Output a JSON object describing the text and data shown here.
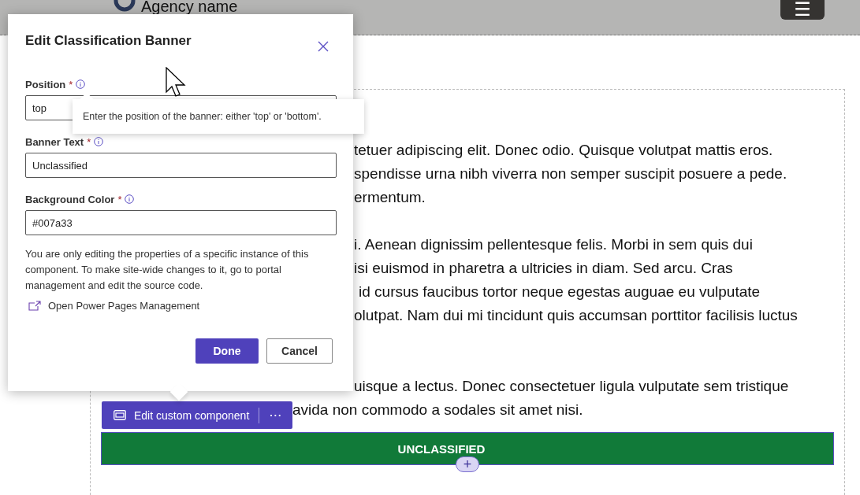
{
  "header": {
    "title": "Agency name",
    "menu_button": "☰"
  },
  "content": {
    "paragraphs": [
      {
        "lines": [
          {
            "text": "tetuer adipiscing elit. Donec odio. Quisque volutpat mattis eros.",
            "kind": "normal"
          },
          {
            "text": "spendisse urna nibh viverra non semper suscipit posuere a pede.",
            "kind": "normal"
          },
          {
            "text": "ermentum.",
            "kind": "normal"
          }
        ]
      },
      {
        "lines": [
          {
            "text": "i. Aenean dignissim pellentesque felis. Morbi in sem quis dui",
            "kind": "normal"
          },
          {
            "text": "isi euismod in pharetra a ultricies in diam. Sed arcu. Cras",
            "kind": "normal"
          },
          {
            "text": "id cursus faucibus tortor neque egestas auguae eu vulputate",
            "kind": "shifted"
          },
          {
            "text": "olutpat. Nam dui mi tincidunt quis accumsan porttitor facilisis luctus",
            "kind": "normal"
          }
        ]
      },
      {
        "lines": [
          {
            "text": "uisque a lectus. Donec consectetuer ligula vulputate sem tristique",
            "kind": "normal"
          },
          {
            "text": "avida non commodo a sodales sit amet nisi.",
            "kind": "wide"
          }
        ]
      }
    ],
    "banner": {
      "text": "UNCLASSIFIED",
      "add_button": "+"
    }
  },
  "toolbar": {
    "label": "Edit custom component",
    "more": "⋯"
  },
  "dialog": {
    "title": "Edit Classification Banner",
    "fields": [
      {
        "label": "Position",
        "required": "*",
        "value": "top"
      },
      {
        "label": "Banner Text",
        "required": "*",
        "value": "Unclassified"
      },
      {
        "label": "Background Color",
        "required": "*",
        "value": "#007a33"
      }
    ],
    "note": "You are only editing the properties of a specific instance of this component. To make site-wide changes to it, go to portal management and edit the source code.",
    "link": "Open Power Pages Management",
    "buttons": [
      {
        "label": "Done",
        "kind": "primary"
      },
      {
        "label": "Cancel",
        "kind": "secondary"
      }
    ]
  },
  "tooltip": {
    "text": "Enter the position of the banner: either 'top' or 'bottom'."
  }
}
